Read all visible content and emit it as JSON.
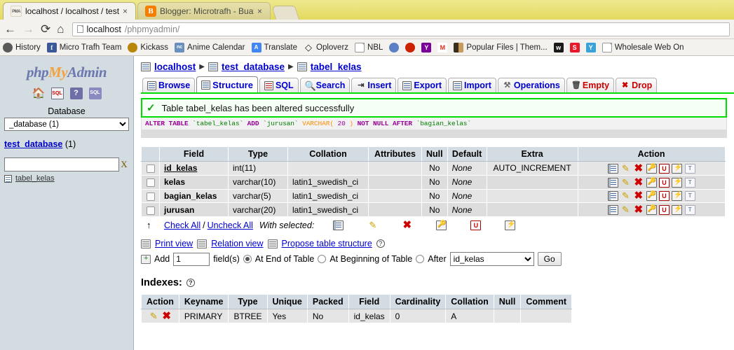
{
  "browser": {
    "tabs": [
      {
        "title": "localhost / localhost / test",
        "favicon": "phpmyadmin-icon",
        "active": true,
        "close": "×"
      },
      {
        "title": "Blogger: Microtrafh - Buat",
        "favicon": "blogger-icon",
        "active": false,
        "close": "×"
      }
    ],
    "nav": {
      "back": "←",
      "forward": "→",
      "reload": "⟳",
      "home": "⌂"
    },
    "url": {
      "domain": "localhost",
      "path": "/phpmyadmin/",
      "full": "localhost/phpmyadmin/"
    },
    "bookmarks": [
      {
        "label": "History",
        "icon": "clock-icon",
        "glyph": ""
      },
      {
        "label": "Micro Trafh Team",
        "icon": "facebook-icon",
        "glyph": "f"
      },
      {
        "label": "Kickass",
        "icon": "kickass-icon",
        "glyph": ""
      },
      {
        "label": "Anime Calendar",
        "icon": "calendar-icon",
        "glyph": "nc"
      },
      {
        "label": "Translate",
        "icon": "translate-icon",
        "glyph": "A"
      },
      {
        "label": "Oploverz",
        "icon": "diamond-icon",
        "glyph": "◇"
      },
      {
        "label": "NBL",
        "icon": "page-icon",
        "glyph": ""
      },
      {
        "label": "",
        "icon": "paw-icon",
        "glyph": ""
      },
      {
        "label": "",
        "icon": "feather-icon",
        "glyph": ""
      },
      {
        "label": "",
        "icon": "yahoo-icon",
        "glyph": "Y"
      },
      {
        "label": "",
        "icon": "gmail-icon",
        "glyph": "M"
      },
      {
        "label": "Popular Files | Them...",
        "icon": "book-icon",
        "glyph": ""
      },
      {
        "label": "",
        "icon": "wikipedia-icon",
        "glyph": "w"
      },
      {
        "label": "",
        "icon": "s-icon",
        "glyph": "S"
      },
      {
        "label": "",
        "icon": "y-blue-icon",
        "glyph": "Y"
      },
      {
        "label": "Wholesale Web On",
        "icon": "page-icon",
        "glyph": ""
      }
    ]
  },
  "sidebar": {
    "logo": {
      "part1": "php",
      "part2": "My",
      "part3": "Admin"
    },
    "icons": [
      {
        "name": "home-icon",
        "glyph": "🏠"
      },
      {
        "name": "sql-query-icon",
        "glyph": "SQL"
      },
      {
        "name": "help-icon",
        "glyph": "?"
      },
      {
        "name": "sql-doc-icon",
        "glyph": "SQL"
      }
    ],
    "database_label": "Database",
    "database_select": "_database (1)",
    "current_database": {
      "name": "test_database",
      "count": "(1)"
    },
    "filter_placeholder": "",
    "filter_value": "",
    "filter_clear": "X",
    "tables": [
      {
        "name": "tabel_kelas"
      }
    ]
  },
  "breadcrumb": {
    "server": "localhost",
    "database": "test_database",
    "table": "tabel_kelas",
    "separator": "▶"
  },
  "tabs": [
    {
      "label": "Browse",
      "icon": "browse-icon",
      "active": false,
      "danger": false
    },
    {
      "label": "Structure",
      "icon": "structure-icon",
      "active": true,
      "danger": false
    },
    {
      "label": "SQL",
      "icon": "sql-icon",
      "active": false,
      "danger": false
    },
    {
      "label": "Search",
      "icon": "search-icon",
      "active": false,
      "danger": false
    },
    {
      "label": "Insert",
      "icon": "insert-icon",
      "active": false,
      "danger": false
    },
    {
      "label": "Export",
      "icon": "export-icon",
      "active": false,
      "danger": false
    },
    {
      "label": "Import",
      "icon": "import-icon",
      "active": false,
      "danger": false
    },
    {
      "label": "Operations",
      "icon": "operations-icon",
      "active": false,
      "danger": false
    },
    {
      "label": "Empty",
      "icon": "empty-icon",
      "active": false,
      "danger": true
    },
    {
      "label": "Drop",
      "icon": "drop-icon",
      "active": false,
      "danger": true
    }
  ],
  "notice": {
    "check": "✓",
    "message": "Table tabel_kelas has been altered successfully",
    "sql": {
      "full": "ALTER TABLE `tabel_kelas` ADD `jurusan` VARCHAR( 20 ) NOT NULL AFTER `bagian_kelas`",
      "kw1": "ALTER TABLE",
      "id1": "`tabel_kelas`",
      "kw2": "ADD",
      "id2": "`jurusan`",
      "type": "VARCHAR(",
      "len": "20",
      "paren": ")",
      "kw3": "NOT NULL AFTER",
      "id3": "`bagian_kelas`"
    }
  },
  "structure": {
    "columns": [
      "",
      "Field",
      "Type",
      "Collation",
      "Attributes",
      "Null",
      "Default",
      "Extra",
      "Action"
    ],
    "rows": [
      {
        "field": "id_kelas",
        "pk": true,
        "type": "int(11)",
        "collation": "",
        "attributes": "",
        "null": "No",
        "default": "None",
        "extra": "AUTO_INCREMENT"
      },
      {
        "field": "kelas",
        "pk": false,
        "type": "varchar(10)",
        "collation": "latin1_swedish_ci",
        "attributes": "",
        "null": "No",
        "default": "None",
        "extra": ""
      },
      {
        "field": "bagian_kelas",
        "pk": false,
        "type": "varchar(5)",
        "collation": "latin1_swedish_ci",
        "attributes": "",
        "null": "No",
        "default": "None",
        "extra": ""
      },
      {
        "field": "jurusan",
        "pk": false,
        "type": "varchar(20)",
        "collation": "latin1_swedish_ci",
        "attributes": "",
        "null": "No",
        "default": "None",
        "extra": ""
      }
    ],
    "action_icons": [
      "browse-distinct-icon",
      "change-icon",
      "drop-icon",
      "primary-icon",
      "unique-icon",
      "index-icon",
      "fulltext-icon"
    ]
  },
  "checkall": {
    "arrow": "↑",
    "check_all": "Check All",
    "slash": "/",
    "uncheck_all": "Uncheck All",
    "with_selected": "With selected:",
    "icons": [
      "browse-icon",
      "change-icon",
      "drop-icon",
      "primary-icon",
      "unique-icon",
      "index-icon"
    ]
  },
  "links": {
    "print_view": "Print view",
    "relation_view": "Relation view",
    "propose": "Propose table structure",
    "help": "?"
  },
  "add_form": {
    "add_label": "Add",
    "count_value": "1",
    "fields_label": "field(s)",
    "at_end": "At End of Table",
    "at_beginning": "At Beginning of Table",
    "after": "After",
    "after_value": "id_kelas",
    "go": "Go",
    "selected_radio": "at_end"
  },
  "indexes": {
    "title": "Indexes:",
    "help": "?",
    "columns": [
      "Action",
      "Keyname",
      "Type",
      "Unique",
      "Packed",
      "Field",
      "Cardinality",
      "Collation",
      "Null",
      "Comment"
    ],
    "rows": [
      {
        "keyname": "PRIMARY",
        "type": "BTREE",
        "unique": "Yes",
        "packed": "No",
        "field": "id_kelas",
        "cardinality": "0",
        "collation": "A",
        "null": "",
        "comment": ""
      }
    ]
  },
  "colors": {
    "accent_green": "#00dd00",
    "link_blue": "#0000cc",
    "danger_red": "#cc0000",
    "sidebar_bg": "#D2DCE1",
    "header_bg": "#D3DCE3",
    "row_bg": "#E5E5E5"
  }
}
